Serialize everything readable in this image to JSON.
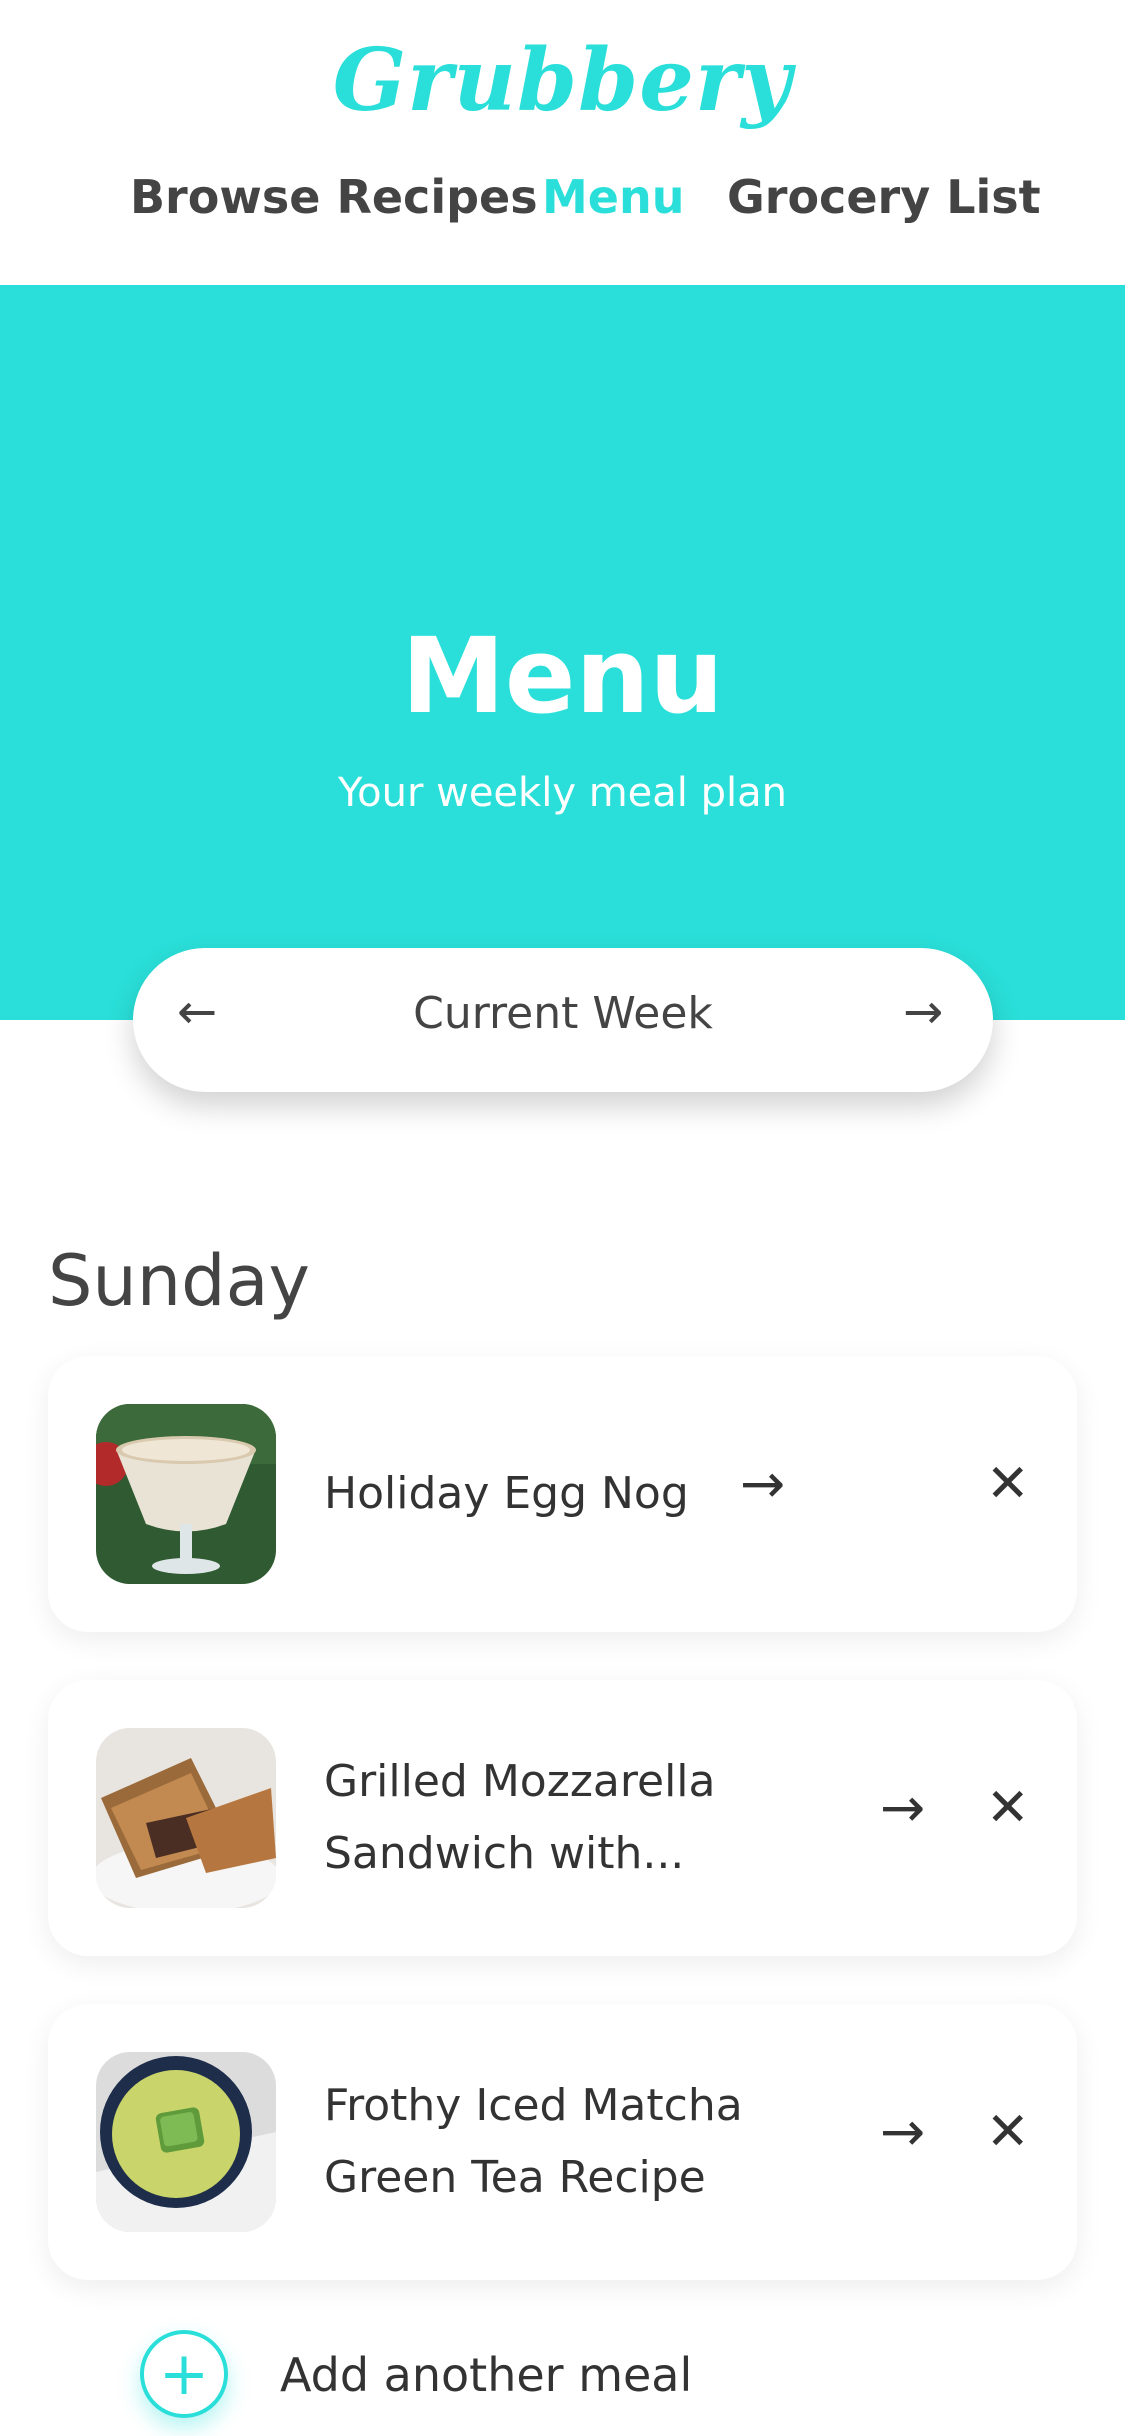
{
  "app": {
    "logo_text": "Grubbery",
    "accent_color": "#2adfd9"
  },
  "nav": {
    "items": [
      {
        "label": "Browse Recipes",
        "active": false
      },
      {
        "label": "Menu",
        "active": true
      },
      {
        "label": "Grocery List",
        "active": false
      }
    ]
  },
  "hero": {
    "title": "Menu",
    "subtitle": "Your weekly meal plan"
  },
  "week_selector": {
    "label": "Current Week",
    "prev_icon": "arrow-left-icon",
    "next_icon": "arrow-right-icon"
  },
  "day": {
    "name": "Sunday",
    "meals": [
      {
        "name": "Holiday Egg Nog",
        "image_description": "egg-nog-thumbnail"
      },
      {
        "name_line1": "Grilled Mozzarella",
        "name_line2": "Sandwich with...",
        "image_description": "grilled-sandwich-thumbnail"
      },
      {
        "name_line1": "Frothy Iced Matcha",
        "name_line2": "Green Tea Recipe",
        "image_description": "matcha-thumbnail"
      }
    ]
  },
  "add_meal": {
    "label": "Add another meal",
    "icon": "plus-circle-icon"
  }
}
